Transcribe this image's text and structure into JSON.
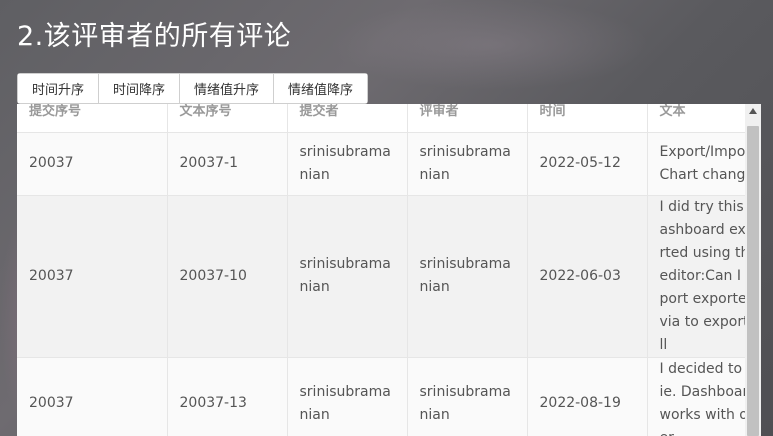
{
  "title": "2.该评审者的所有评论",
  "sort_buttons": [
    "时间升序",
    "时间降序",
    "情绪值升序",
    "情绪值降序"
  ],
  "table": {
    "headers": [
      "提交序号",
      "文本序号",
      "提交者",
      "评审者",
      "时间",
      "文本"
    ],
    "rows": [
      [
        "20037",
        "20037-1",
        "srinisubramanian",
        "srinisubramanian",
        "2022-05-12",
        "Export/Import Chart changes"
      ],
      [
        "20037",
        "20037-10",
        "srinisubramanian",
        "srinisubramanian",
        "2022-06-03",
        "I did try this dashboard exported using the editor:Can I import exported via to export all"
      ],
      [
        "20037",
        "20037-13",
        "srinisubramanian",
        "srinisubramanian",
        "2022-08-19",
        "I decided to ity ie. Dashboard works with over"
      ]
    ]
  }
}
